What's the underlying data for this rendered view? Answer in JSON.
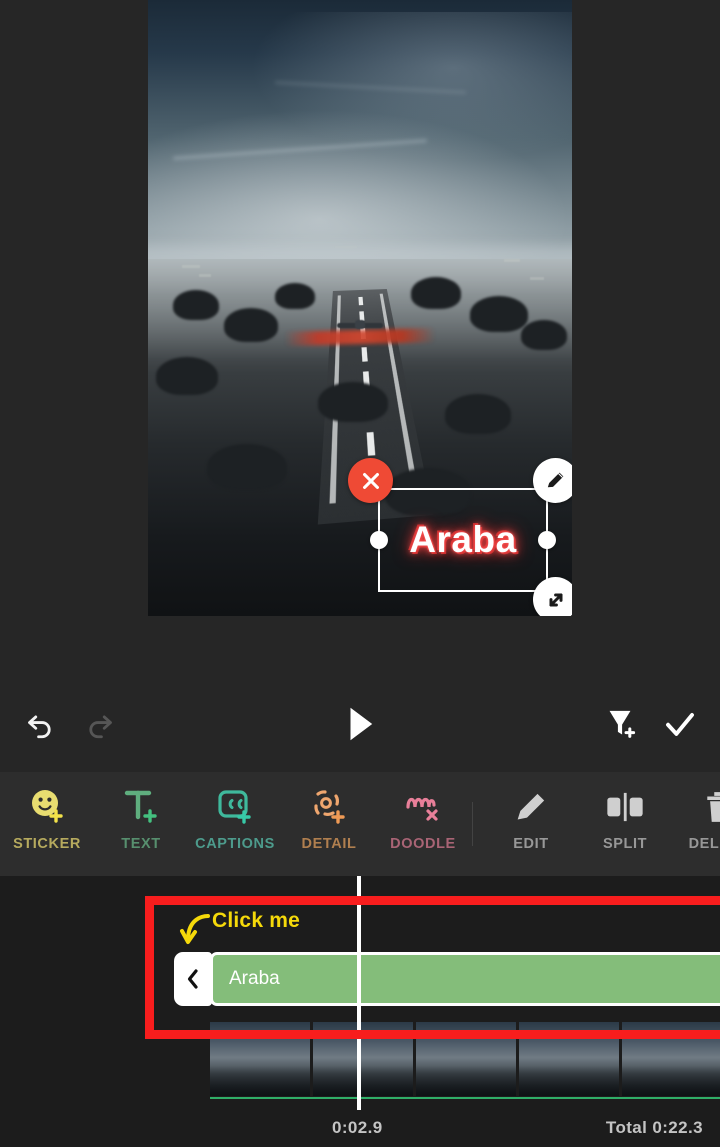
{
  "app": {
    "kind": "mobile-video-editor",
    "background": "#262626"
  },
  "preview": {
    "scene_description": "Aerial view of an airplane landing on a runway in a hazy valley town",
    "overlay_text": {
      "value": "Araba",
      "color": "#ffffff",
      "glow_color": "#f24b4b",
      "handles": {
        "close": "close-icon",
        "edit": "pencil-icon",
        "resize": "resize-diagonal-icon"
      }
    }
  },
  "action_bar": {
    "undo": {
      "label": "Undo",
      "icon": "undo-arrow-icon",
      "enabled": true
    },
    "redo": {
      "label": "Redo",
      "icon": "redo-arrow-icon",
      "enabled": false
    },
    "play": {
      "label": "Play",
      "icon": "play-triangle-icon"
    },
    "marker": {
      "label": "Add Keyframe",
      "icon": "add-marker-icon"
    },
    "done": {
      "label": "Done",
      "icon": "checkmark-icon"
    }
  },
  "tools": [
    {
      "label": "STICKER",
      "icon": "sticker-smiley-plus-icon",
      "color": "#d9d06a",
      "accent": "#e8d860"
    },
    {
      "label": "TEXT",
      "icon": "text-t-plus-icon",
      "color": "#6fae84",
      "accent": "#63b07f"
    },
    {
      "label": "CAPTIONS",
      "icon": "captions-cc-plus-icon",
      "color": "#5bb49e",
      "accent": "#3fbfa0"
    },
    {
      "label": "DETAIL",
      "icon": "detail-target-plus-icon",
      "color": "#c08a55",
      "accent": "#efa66e"
    },
    {
      "label": "DOODLE",
      "icon": "doodle-squiggle-plus-icon",
      "color": "#b96f7d",
      "accent": "#e87f99"
    },
    {
      "label": "EDIT",
      "icon": "pencil-icon",
      "color": "#9a9a9a",
      "accent": "#cfcfcf"
    },
    {
      "label": "SPLIT",
      "icon": "split-icon",
      "color": "#9a9a9a",
      "accent": "#cfcfcf"
    },
    {
      "label": "DELETE",
      "icon": "trash-icon",
      "color": "#9a9a9a",
      "accent": "#cfcfcf"
    }
  ],
  "timeline": {
    "text_clip": {
      "label": "Araba",
      "color": "#84bd7a",
      "left_handle_icon": "chevron-left-icon"
    },
    "playhead_position": "0:02.9",
    "current_time": "0:02.9",
    "total_time": "Total 0:22.3"
  },
  "annotation": {
    "label": "Click me",
    "label_color": "#f5d90a",
    "box_color": "#f81d1d",
    "arrow_icon": "curved-down-left-arrow-icon"
  }
}
